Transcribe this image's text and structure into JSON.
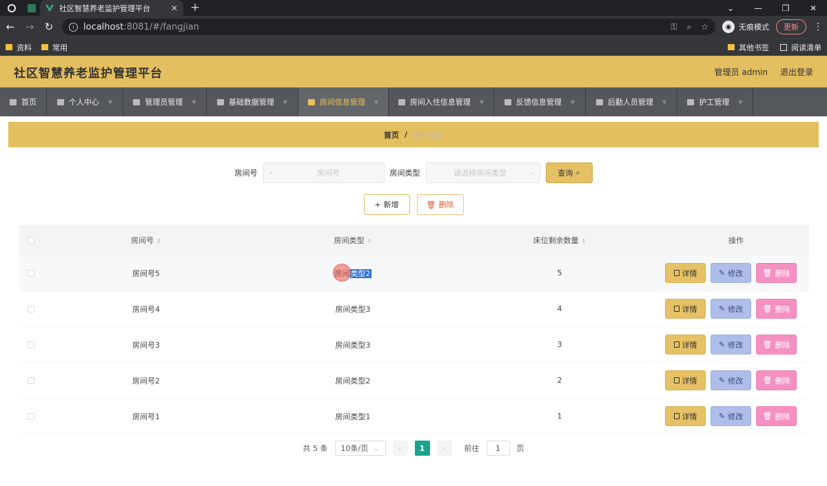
{
  "browser": {
    "tab_title": "社区智慧养老监护管理平台",
    "url_host": "localhost",
    "url_rest": ":8081/#/fangjian",
    "profile_label": "无痕模式",
    "update_label": "更新",
    "bookmarks": [
      "资料",
      "常用"
    ],
    "bookmarks_right": [
      "其他书签",
      "阅读清单"
    ]
  },
  "app": {
    "title": "社区智慧养老监护管理平台",
    "user": "管理员 admin",
    "logout": "退出登录"
  },
  "menu": [
    {
      "label": "首页",
      "icon": "home-icon"
    },
    {
      "label": "个人中心",
      "icon": "user-icon"
    },
    {
      "label": "管理员管理",
      "icon": "admin-icon"
    },
    {
      "label": "基础数据管理",
      "icon": "data-icon"
    },
    {
      "label": "房间信息管理",
      "icon": "grid-icon",
      "active": true
    },
    {
      "label": "房间入住信息管理",
      "icon": "checkin-icon"
    },
    {
      "label": "反馈信息管理",
      "icon": "mail-icon"
    },
    {
      "label": "后勤人员管理",
      "icon": "gear-icon"
    },
    {
      "label": "护工管理",
      "icon": "nurse-icon"
    }
  ],
  "breadcrumb": {
    "home": "首页",
    "separator": "/",
    "current": "房间信息"
  },
  "search": {
    "room_label": "房间号",
    "room_placeholder": "房间号",
    "type_label": "房间类型",
    "type_placeholder": "请选择房间类型",
    "query_label": "查询"
  },
  "actions": {
    "add_label": "新增",
    "delete_label": "删除"
  },
  "table": {
    "headers": {
      "room": "房间号",
      "type": "房间类型",
      "beds": "床位剩余数量",
      "ops": "操作"
    },
    "rows": [
      {
        "room": "房间号5",
        "type_pre": "房间",
        "type_sel": "类型2",
        "type": "房间类型2",
        "beds": "5"
      },
      {
        "room": "房间号4",
        "type": "房间类型3",
        "beds": "4"
      },
      {
        "room": "房间号3",
        "type": "房间类型3",
        "beds": "3"
      },
      {
        "room": "房间号2",
        "type": "房间类型2",
        "beds": "2"
      },
      {
        "room": "房间号1",
        "type": "房间类型1",
        "beds": "1"
      }
    ],
    "op_labels": {
      "detail": "详情",
      "edit": "修改",
      "delete": "删除"
    }
  },
  "pager": {
    "total": "共 5 条",
    "page_size": "10条/页",
    "current_page": "1",
    "goto_prefix": "前往",
    "goto_value": "1",
    "goto_suffix": "页"
  },
  "colors": {
    "header": "#e4bf5f",
    "menubar": "#54575b",
    "active_menu_text": "#e9c05f",
    "edit_button": "#aebde9",
    "delete_button": "#f590c2",
    "pager_active": "#1aa28e"
  }
}
